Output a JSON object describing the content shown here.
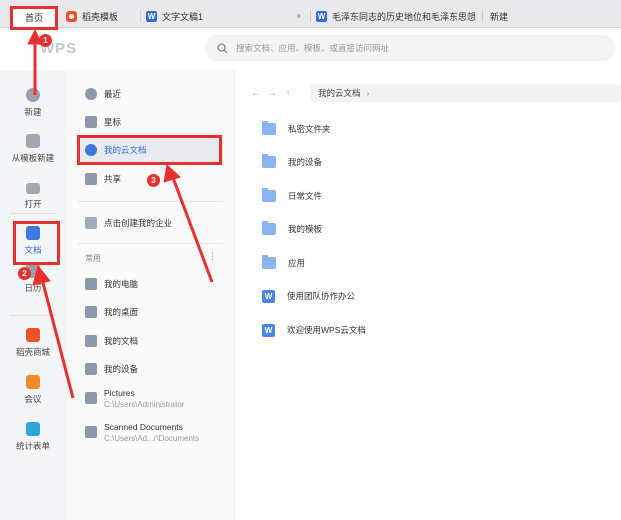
{
  "tabs": {
    "home": "首页",
    "daoke": "稻壳模板",
    "doc1": "文字文稿1",
    "mao": "毛泽东同志的历史地位和毛泽东思想",
    "new": "新建"
  },
  "logo": "WPS",
  "search": {
    "placeholder": "搜索文档、应用、模板、或直接访问网址"
  },
  "rail": {
    "new": "新建",
    "from_template": "从模板新建",
    "open": "打开",
    "docs": "文档",
    "calendar": "日历",
    "daoke_mall": "稻壳商城",
    "meeting": "会议",
    "forms": "统计表单"
  },
  "nav": {
    "recent": "最近",
    "starred": "星标",
    "cloud": "我的云文档",
    "shared": "共享",
    "create_enterprise": "点击创建我的企业",
    "common_label": "常用",
    "more": "⋮",
    "my_computer": "我的电脑",
    "my_desktop": "我的桌面",
    "my_documents": "我的文档",
    "my_devices": "我的设备",
    "pictures_name": "Pictures",
    "pictures_path": "C:\\Users\\Administrator",
    "scanned_name": "Scanned Documents",
    "scanned_path": "C:\\Users\\Ad...r\\Documents"
  },
  "main": {
    "back": "←",
    "forward": "→",
    "up": "↑",
    "breadcrumb": "我的云文档",
    "files": [
      {
        "name": "私密文件夹",
        "icon": "lock-folder-icon"
      },
      {
        "name": "我的设备",
        "icon": "device-folder-icon"
      },
      {
        "name": "日常文件",
        "icon": "folder-icon"
      },
      {
        "name": "我的模板",
        "icon": "folder-icon"
      },
      {
        "name": "应用",
        "icon": "folder-icon"
      },
      {
        "name": "使用团队协作办公",
        "icon": "word-doc-icon"
      },
      {
        "name": "欢迎使用WPS云文档",
        "icon": "word-doc-icon"
      }
    ]
  },
  "annotations": {
    "step1": "1",
    "step2": "2",
    "step3": "3"
  },
  "colors": {
    "annotation_red": "#e8312f",
    "accent_blue": "#2f6fd6",
    "folder_blue": "#8ab4ef"
  }
}
